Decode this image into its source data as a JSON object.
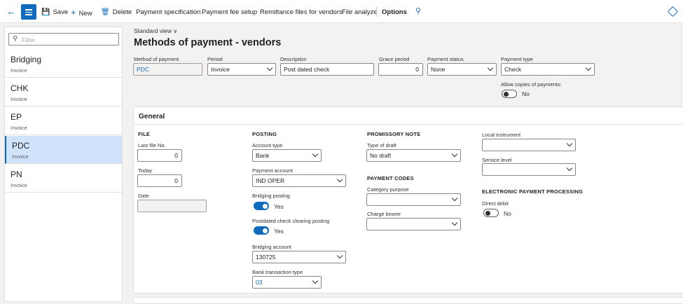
{
  "toolbar": {
    "save": "Save",
    "new": "New",
    "delete": "Delete",
    "payment_specification": "Payment specification",
    "payment_fee_setup": "Payment fee setup",
    "remittance_files": "Remittance files for vendors",
    "file_analyze": "File analyze",
    "options": "Options"
  },
  "left_pane": {
    "filter_placeholder": "Filter",
    "items": [
      {
        "name": "Bridging",
        "sub": "Invoice"
      },
      {
        "name": "CHK",
        "sub": "Invoice"
      },
      {
        "name": "EP",
        "sub": "Invoice"
      },
      {
        "name": "PDC",
        "sub": "Invoice"
      },
      {
        "name": "PN",
        "sub": "Invoice"
      }
    ],
    "selected": "PDC"
  },
  "header": {
    "view": "Standard view",
    "title": "Methods of payment - vendors"
  },
  "top_fields": {
    "method_label": "Method of payment",
    "method_value": "PDC",
    "period_label": "Period",
    "period_value": "Invoice",
    "description_label": "Description",
    "description_value": "Post dated check",
    "grace_label": "Grace period",
    "grace_value": "0",
    "status_label": "Payment status",
    "status_value": "None",
    "type_label": "Payment type",
    "type_value": "Check",
    "allow_copies_label": "Allow copies of payments:",
    "allow_copies_value": "No"
  },
  "general": {
    "title": "General",
    "file": {
      "heading": "FILE",
      "last_file_label": "Last file No.",
      "last_file_value": "0",
      "today_label": "Today",
      "today_value": "0",
      "date_label": "Date",
      "date_value": ""
    },
    "posting": {
      "heading": "POSTING",
      "account_type_label": "Account type",
      "account_type_value": "Bank",
      "payment_account_label": "Payment account",
      "payment_account_value": "IND OPER",
      "bridging_posting_label": "Bridging posting",
      "bridging_posting_value": "Yes",
      "postdated_label": "Postdated check clearing posting",
      "postdated_value": "Yes",
      "bridging_account_label": "Bridging account",
      "bridging_account_value": "130725",
      "bank_tx_label": "Bank transaction type",
      "bank_tx_value": "03"
    },
    "promissory": {
      "heading": "PROMISSORY NOTE",
      "type_of_draft_label": "Type of draft",
      "type_of_draft_value": "No draft"
    },
    "payment_codes": {
      "heading": "PAYMENT CODES",
      "category_label": "Category purpose",
      "category_value": "",
      "charge_label": "Charge bearer",
      "charge_value": ""
    },
    "local": {
      "local_instrument_label": "Local instrument",
      "local_instrument_value": "",
      "service_level_label": "Service level",
      "service_level_value": ""
    },
    "electronic": {
      "heading": "ELECTRONIC PAYMENT PROCESSING",
      "direct_debit_label": "Direct debit",
      "direct_debit_value": "No"
    }
  },
  "colors": {
    "accent": "#0f6cbd",
    "selected_row": "#cfe4fa",
    "background": "#f3f2f1"
  }
}
